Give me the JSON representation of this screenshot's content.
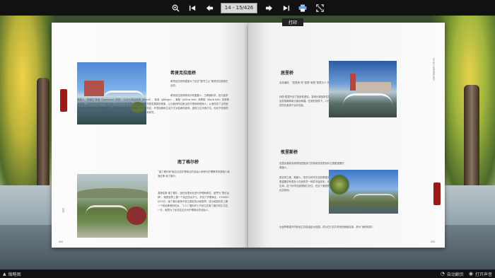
{
  "toolbar": {
    "zoom_icon": "zoom-in-icon",
    "page_indicator": "14 - 15/426",
    "print_label": "打印"
  },
  "left_page": {
    "heading1": "希贤克拉底桥",
    "para1": "希贤克拉底桥建造为了纪念“图书之父”希贤克拉底而在后的。",
    "para2": "希贤克拉底桥跨河亦有重要人，古希腊科学、西方医学奠基人、他随位“体液（humours）学说”，认为人体由血液（blood）、粘液（phlegm）、黄胆（yellow bile）和黑胆（black bile）四种体液组成。这四种体液的不同配合使人们有不同的体质。他把疾病看作是发展着的现象，认为医师所应医治的不是病而是病人；从而改变了当时医学中以巫术和宗教为根据的观念。他主张在治疗上注意病人的个性特征、环境因素和生活方式对患病的影响。重视卫生饮食疗法，但也不忽视药物治疗，尤其注意对症治疗和预防。他对骨骼、关节、肌肉等都很有研究。",
    "heading2": "南丁格尔桥",
    "para3": "“南丁格尔桥”取名纪念护理事业的创始人和现代护理教育的奠基人弗洛伦斯·南丁格尔。",
    "para4": "弗洛伦斯·南丁格尔，因在克里米亚进行护理而闻名，被誉为“提灯女神”。她是世界上第一个真正的女护士，开创了护理事业。1908年3月16日，南丁格尔被授予英王颁发的功绩勋章，成为英国历史上第一个获此殊荣的妇女。“5.12”国际护士节设立在南丁格尔的生日这一天，就是为了纪念这位近代护理事业的创始人。",
    "side_text": "桥梁",
    "page_number": "002"
  },
  "right_page": {
    "heading1": "居里桥",
    "para1": "自信谦谨，“居里桥”的“居里”就是“居里夫人”的“居里”。",
    "para2": "玛丽·居里开创了放射性理论，发明分离放射性同位素技术，以及发现两种新元素钋和镭。在她的指导下，人们第一次将放射性同位素用于治疗癌症。",
    "heading2": "攸里斯桥",
    "para3": "这里坐落着安静的校园旅游门的桥绍念的是安科王国更重要的希腊人。",
    "para4": "是自然之美、希腊人、历史与科学文化的希腊文化里的重要，更重要的有很多人在我的学一种并尽独关系，也为科学献出了生命。这个科学也值得我们记住，在这个美丽的山林里，人们纪念着他。",
    "para5": "为追梦希望不同的准立将能追赶大校园，成功它们共存育育的跨越至事，即为“美丽校园”。",
    "side_text": "学生在工程思维的体现",
    "page_number": "003"
  },
  "bottombar": {
    "left_label": "缩略图",
    "autoplay_label": "自动翻页",
    "sound_label": "打开声音"
  }
}
